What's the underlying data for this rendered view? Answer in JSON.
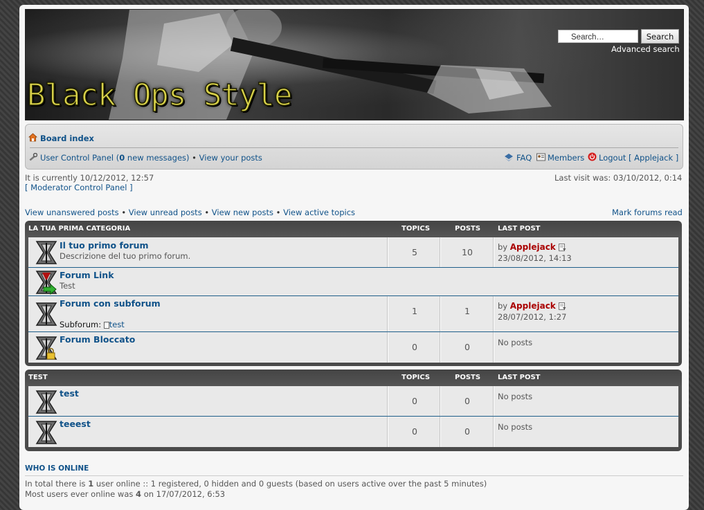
{
  "header": {
    "logo_text": "Black Ops Style",
    "search_placeholder": "Search…",
    "search_button": "Search",
    "advanced_search": "Advanced search"
  },
  "navbar": {
    "board_index": "Board index",
    "ucp_prefix": "User Control Panel (",
    "new_messages_count": "0",
    "ucp_suffix": " new messages)",
    "bullet": " • ",
    "view_posts": "View your posts",
    "faq": "FAQ",
    "members": "Members",
    "logout": "Logout [ Applejack ]"
  },
  "status": {
    "current_time": "It is currently 10/12/2012, 12:57",
    "mcp": "[ Moderator Control Panel ]",
    "last_visit": "Last visit was: 03/10/2012, 0:14"
  },
  "quick_links": {
    "unanswered": "View unanswered posts",
    "unread": "View unread posts",
    "new": "View new posts",
    "active": "View active topics",
    "sep": " • ",
    "mark_read": "Mark forums read"
  },
  "categories": [
    {
      "name": "LA TUA PRIMA CATEGORIA",
      "col_topics": "TOPICS",
      "col_posts": "POSTS",
      "col_last": "LAST POST",
      "forums": [
        {
          "title": "Il tuo primo forum",
          "desc": "Descrizione del tuo primo forum.",
          "topics": "5",
          "posts": "10",
          "last_by": "by ",
          "last_user": "Applejack",
          "last_date": "23/08/2012, 14:13"
        },
        {
          "title": "Forum Link",
          "desc": "Test"
        },
        {
          "title": "Forum con subforum",
          "subforum_label": "Subforum:",
          "subforum": "test",
          "topics": "1",
          "posts": "1",
          "last_by": "by ",
          "last_user": "Applejack",
          "last_date": "28/07/2012, 1:27"
        },
        {
          "title": "Forum Bloccato",
          "topics": "0",
          "posts": "0",
          "last_none": "No posts"
        }
      ]
    },
    {
      "name": "TEST",
      "col_topics": "TOPICS",
      "col_posts": "POSTS",
      "col_last": "LAST POST",
      "forums": [
        {
          "title": "test",
          "topics": "0",
          "posts": "0",
          "last_none": "No posts"
        },
        {
          "title": "teeest",
          "topics": "0",
          "posts": "0",
          "last_none": "No posts"
        }
      ]
    }
  ],
  "online": {
    "title": "WHO IS ONLINE",
    "line1_a": "In total there is ",
    "line1_count": "1",
    "line1_b": " user online :: 1 registered, 0 hidden and 0 guests (based on users active over the past 5 minutes)",
    "line2_a": "Most users ever online was ",
    "line2_count": "4",
    "line2_b": " on 17/07/2012, 6:53"
  }
}
